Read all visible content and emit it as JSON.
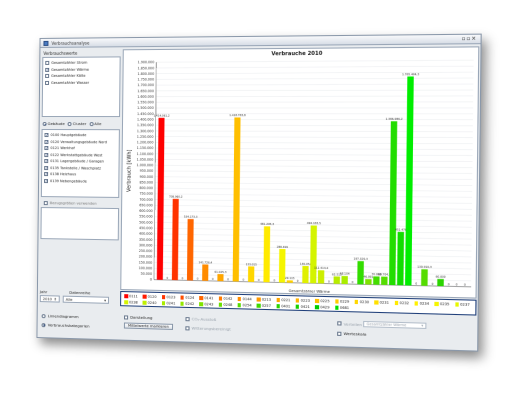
{
  "window": {
    "title": "Verbrauchsanalyse"
  },
  "left": {
    "group_label": "Verbrauchswerte",
    "types": [
      {
        "label": "Gesamtzähler Strom",
        "checked": false
      },
      {
        "label": "Gesamtzähler Wärme",
        "checked": true
      },
      {
        "label": "Gesamtzähler Kälte",
        "checked": false
      },
      {
        "label": "Gesamtzähler Wasser",
        "checked": false
      }
    ],
    "mode_options": [
      {
        "label": "Gebäude",
        "selected": true
      },
      {
        "label": "Cluster",
        "selected": false
      },
      {
        "label": "Alle",
        "selected": false
      }
    ],
    "buildings": [
      {
        "label": "0100 Hauptgebäude",
        "checked": true
      },
      {
        "label": "0120 Verwaltungsgebäude Nord",
        "checked": true
      },
      {
        "label": "0121 Werkhof",
        "checked": true
      },
      {
        "label": "0122 Werkstattgebäude West",
        "checked": true
      },
      {
        "label": "0131 Lagergebäude / Garagen",
        "checked": true
      },
      {
        "label": "0135 Tankstelle / Waschplatz",
        "checked": true
      },
      {
        "label": "0138 Heizhaus",
        "checked": true
      },
      {
        "label": "0139 Nebengebäude",
        "checked": true
      }
    ],
    "option_label": "Bezugsgrößen verwenden",
    "year_label": "Jahr",
    "year_value": "2010",
    "range_label": "Datenreihe",
    "range_value": "Alle"
  },
  "chart_data": {
    "type": "bar",
    "title": "Verbrauche 2010",
    "xlabel": "Gesamtzähler Wärme",
    "ylabel": "Verbrauch [kWh]",
    "ylim": [
      0,
      1900000
    ],
    "yticks": [
      "0",
      "50.000",
      "100.000",
      "150.000",
      "200.000",
      "250.000",
      "300.000",
      "350.000",
      "400.000",
      "450.000",
      "500.000",
      "550.000",
      "600.000",
      "650.000",
      "700.000",
      "750.000",
      "800.000",
      "850.000",
      "900.000",
      "950.000",
      "1.000.000",
      "1.050.000",
      "1.100.000",
      "1.150.000",
      "1.200.000",
      "1.250.000",
      "1.300.000",
      "1.350.000",
      "1.400.000",
      "1.450.000",
      "1.500.000",
      "1.550.000",
      "1.600.000",
      "1.650.000",
      "1.700.000",
      "1.750.000",
      "1.800.000",
      "1.850.000",
      "1.900.000"
    ],
    "categories": [
      "0111",
      "0120",
      "0123",
      "0124",
      "0141",
      "0142",
      "0144",
      "0213",
      "0221",
      "0223",
      "0225",
      "0229",
      "0230",
      "0231",
      "0232",
      "0234",
      "0235",
      "0237",
      "0238",
      "0240",
      "0241",
      "0242",
      "0243",
      "0248",
      "0254",
      "0257",
      "0401",
      "0421",
      "0429",
      "0681"
    ],
    "values": [
      1414000,
      0,
      708000,
      0,
      534000,
      0,
      141700,
      0,
      61000,
      0,
      1418000,
      0,
      133000,
      0,
      481000,
      0,
      288000,
      0,
      494000,
      0,
      68000,
      0,
      46000,
      0,
      139000,
      0,
      60000,
      0,
      0,
      0
    ],
    "colors": [
      "#ff0000",
      "#ff1a00",
      "#ff3300",
      "#ff4d00",
      "#ff6600",
      "#ff7a00",
      "#ff8c00",
      "#ff9900",
      "#ffa600",
      "#ffb300",
      "#ffbf00",
      "#ffcc00",
      "#ffd700",
      "#ffe000",
      "#ffea00",
      "#fff000",
      "#f5f500",
      "#e6f700",
      "#d4f400",
      "#bff000",
      "#aaed00",
      "#94e800",
      "#7fe300",
      "#6ae000",
      "#55dc00",
      "#40d800",
      "#2bd400",
      "#16d000",
      "#00cc00",
      "#00e000"
    ],
    "bar_labels": [
      "1.414.061,2",
      "0",
      "708.960,2",
      "0",
      "534.173,3",
      "0",
      "141.726,4",
      "0",
      "61.025,3",
      "0",
      "1.418.783,8",
      "0",
      "133.015",
      "0",
      "481.295,3",
      "0",
      "288.491",
      "0",
      "494.183,5",
      "0",
      "68.104",
      "0",
      "46.091",
      "0",
      "139.910,3",
      "0",
      "60.000",
      "0",
      "0",
      "0"
    ]
  },
  "chart_extra_bars": [
    {
      "label": "20.115",
      "value": 20115,
      "color": "#ffd000"
    },
    {
      "label": "146.052",
      "value": 146052,
      "color": "#e0f000"
    },
    {
      "label": "112.414,4",
      "value": 112414,
      "color": "#ccee00"
    },
    {
      "label": "62.513",
      "value": 62513,
      "color": "#b8ec00"
    },
    {
      "label": "197.320,3",
      "value": 197320,
      "color": "#33dd00"
    },
    {
      "label": "70.088",
      "value": 70088,
      "color": "#44dd00"
    },
    {
      "label": "69.704,4",
      "value": 69704,
      "color": "#55dd00"
    },
    {
      "label": "1.386.986,2",
      "value": 1386986,
      "color": "#22dd00"
    },
    {
      "label": "451.478",
      "value": 451478,
      "color": "#11dd00"
    },
    {
      "label": "1.765.494,3",
      "value": 1765494,
      "color": "#00ee00"
    }
  ],
  "bottom": {
    "radio_1": "Liniendiagramm",
    "radio_2": "Verbrauchskategorien",
    "check_1": "Darstellung",
    "btn_1": "Mittelwerte markieren",
    "check_2": "CO₂-Ausstoß",
    "check_3": "Witterungsbereinigt",
    "check_4": "Verteilen",
    "dd_value": "Gesamtzähler Wärme",
    "check_5": "Werteskala"
  }
}
